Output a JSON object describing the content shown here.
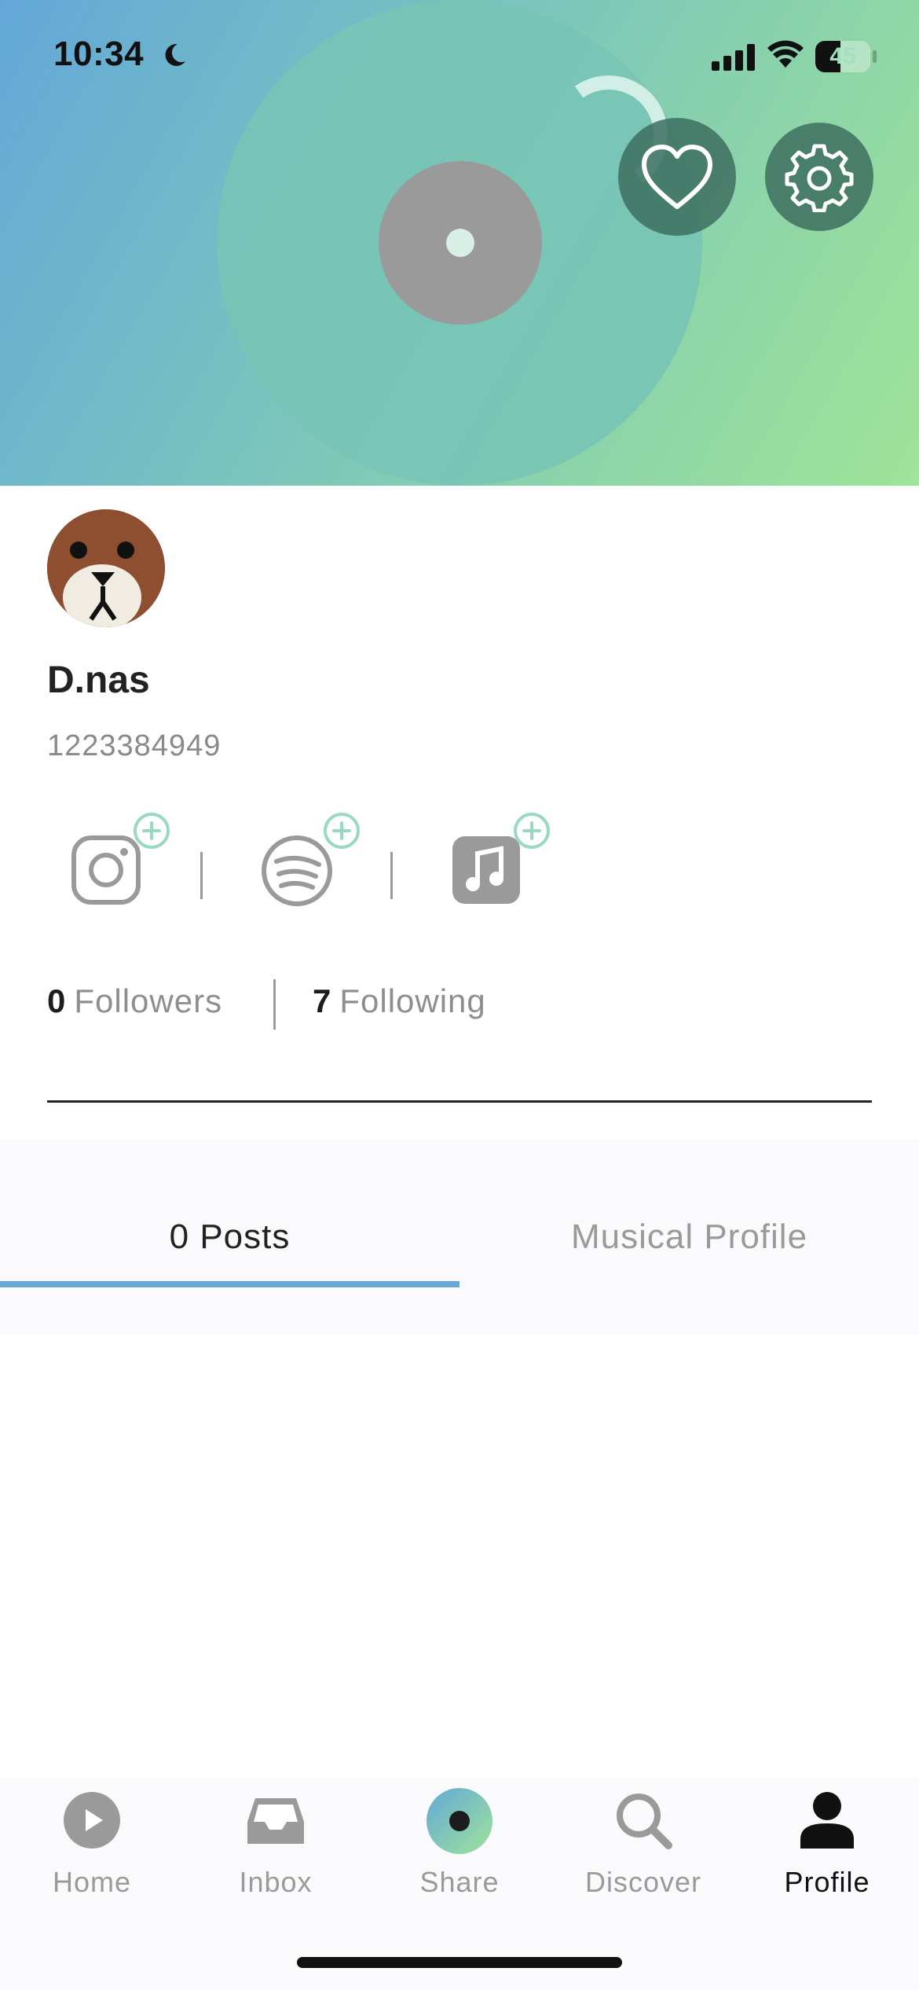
{
  "status_bar": {
    "time": "10:34",
    "battery": "45",
    "battery_level": 0.45
  },
  "profile": {
    "name": "D.nas",
    "id": "1223384949"
  },
  "social_links": [
    "instagram-icon",
    "spotify-icon",
    "apple-music-icon"
  ],
  "stats": {
    "followers_count": "0",
    "followers_label": "Followers",
    "following_count": "7",
    "following_label": "Following"
  },
  "tabs": [
    {
      "label": "0 Posts",
      "active": true
    },
    {
      "label": "Musical Profile",
      "active": false
    }
  ],
  "bottom_nav": [
    {
      "label": "Home",
      "icon": "play-icon",
      "active": false
    },
    {
      "label": "Inbox",
      "icon": "inbox-icon",
      "active": false
    },
    {
      "label": "Share",
      "icon": "share-icon",
      "active": false
    },
    {
      "label": "Discover",
      "icon": "search-icon",
      "active": false
    },
    {
      "label": "Profile",
      "icon": "person-icon",
      "active": true
    }
  ],
  "colors": {
    "accent": "#69a9d8",
    "plus_badge": "#9ad8c6"
  }
}
